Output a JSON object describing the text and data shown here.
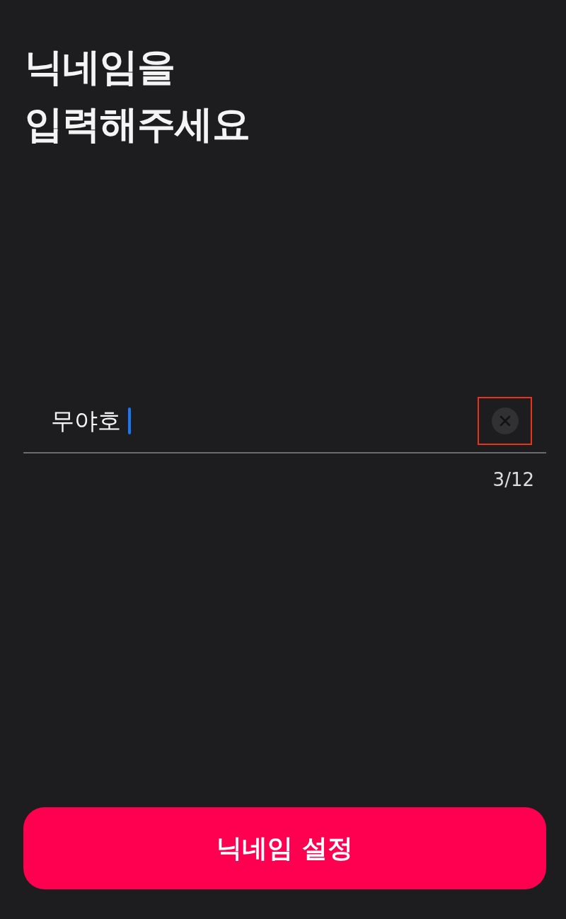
{
  "heading": {
    "lines": [
      "닉네임을",
      "입력해주세요"
    ]
  },
  "nickname_field": {
    "value": "무야호",
    "focused": true,
    "clear_button": {
      "highlighted": true
    },
    "counter": "3/12"
  },
  "submit_button": {
    "label": "닉네임 설정"
  }
}
